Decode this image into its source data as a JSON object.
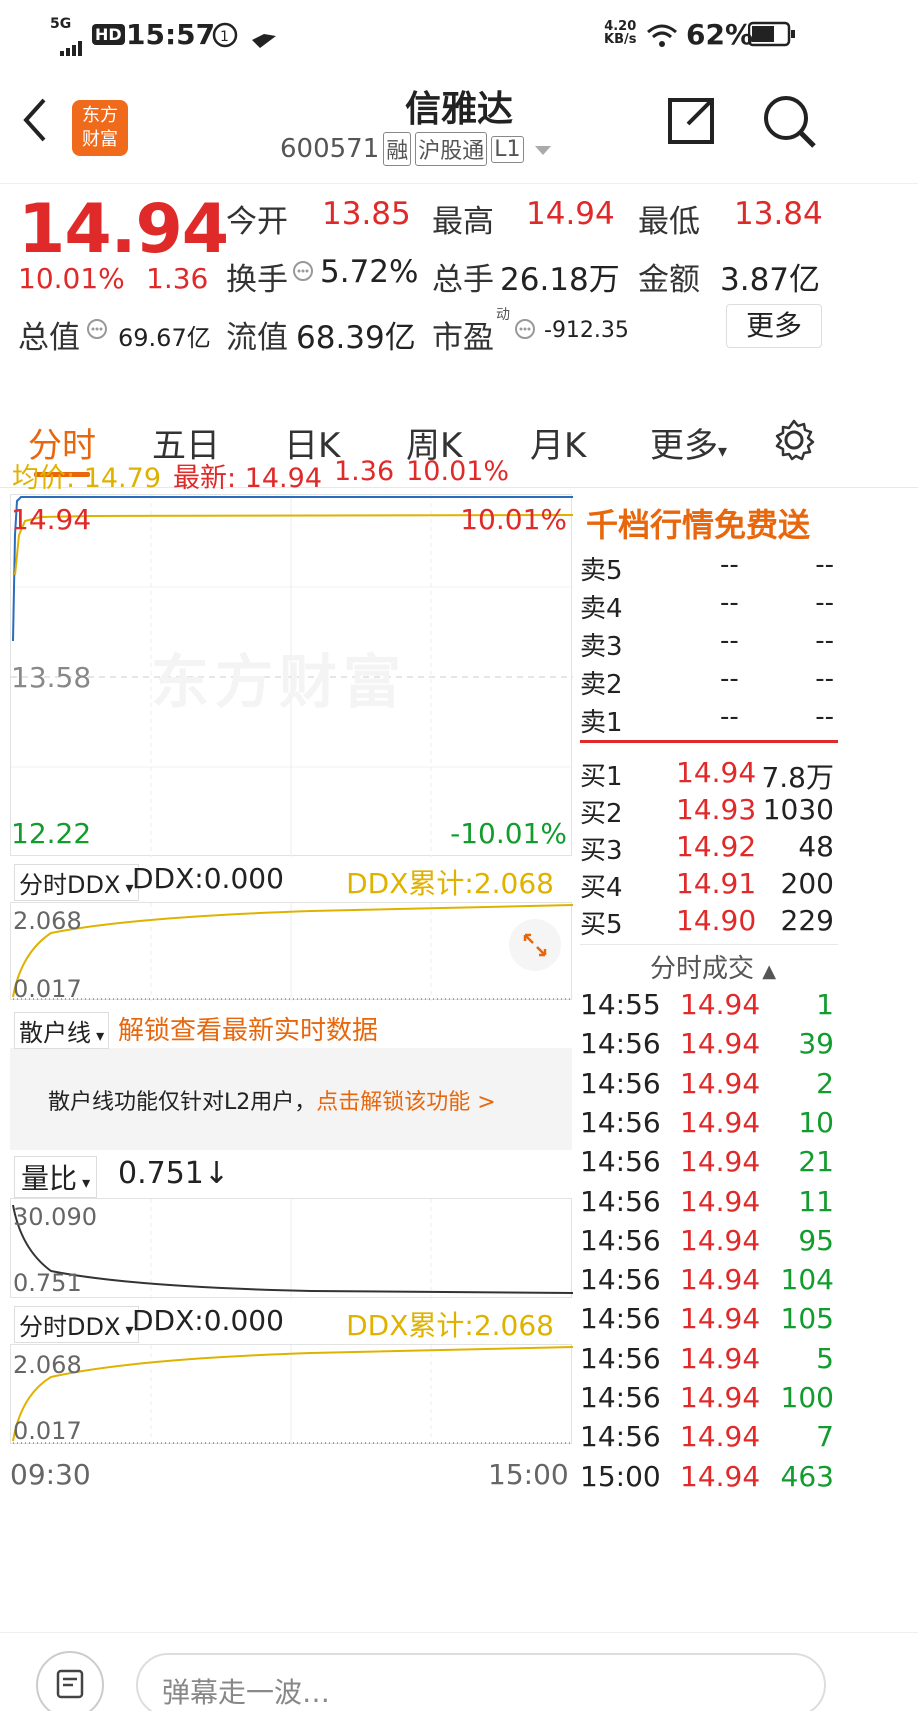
{
  "status": {
    "network": "5G",
    "hd": "HD",
    "time": "15:57",
    "speed_top": "4.20",
    "speed_bottom": "KB/s",
    "battery": "62%"
  },
  "header": {
    "title": "信雅达",
    "code": "600571",
    "badges": [
      "融",
      "沪股通",
      "L1"
    ],
    "logo_line1": "东方",
    "logo_line2": "财富"
  },
  "quote": {
    "price": "14.94",
    "change_pct": "10.01%",
    "change": "1.36",
    "open_label": "今开",
    "open": "13.85",
    "high_label": "最高",
    "high": "14.94",
    "low_label": "最低",
    "low": "13.84",
    "turnover_label": "换手",
    "turnover": "5.72%",
    "volume_label": "总手",
    "volume": "26.18万",
    "amount_label": "金额",
    "amount": "3.87亿",
    "mktcap_label": "总值",
    "mktcap": "69.67亿",
    "float_label": "流值",
    "float": "68.39亿",
    "pe_label": "市盈",
    "pe_sup": "动",
    "pe": "-912.35",
    "more": "更多"
  },
  "tabs": [
    "分时",
    "五日",
    "日K",
    "周K",
    "月K",
    "更多"
  ],
  "intraday": {
    "avg_label": "均价:",
    "avg": "14.79",
    "latest_label": "最新:",
    "latest": "14.94",
    "latest_change": "1.36",
    "latest_pct": "10.01%",
    "y_top": "14.94",
    "y_mid": "13.58",
    "y_bot": "12.22",
    "pct_top": "10.01%",
    "pct_bot": "-10.01%",
    "watermark": "东方财富",
    "time_start": "09:30",
    "time_end": "15:00"
  },
  "ddx1": {
    "selector": "分时DDX",
    "ddx": "DDX:0.000",
    "cum": "DDX累计:2.068",
    "y_top": "2.068",
    "y_bot": "0.017"
  },
  "retail": {
    "selector": "散户线",
    "promo": "解锁查看最新实时数据",
    "notice": "散户线功能仅针对L2用户，",
    "notice_link": "点击解锁该功能 >"
  },
  "volratio": {
    "selector": "量比",
    "value": "0.751↓",
    "y_top": "30.090",
    "y_bot": "0.751"
  },
  "ddx2": {
    "selector": "分时DDX",
    "ddx": "DDX:0.000",
    "cum": "DDX累计:2.068",
    "y_top": "2.068",
    "y_bot": "0.017"
  },
  "orderbook": {
    "banner": "千档行情免费送",
    "sells": [
      {
        "label": "卖5",
        "price": "--",
        "vol": "--"
      },
      {
        "label": "卖4",
        "price": "--",
        "vol": "--"
      },
      {
        "label": "卖3",
        "price": "--",
        "vol": "--"
      },
      {
        "label": "卖2",
        "price": "--",
        "vol": "--"
      },
      {
        "label": "卖1",
        "price": "--",
        "vol": "--"
      }
    ],
    "buys": [
      {
        "label": "买1",
        "price": "14.94",
        "vol": "7.8万"
      },
      {
        "label": "买2",
        "price": "14.93",
        "vol": "1030"
      },
      {
        "label": "买3",
        "price": "14.92",
        "vol": "48"
      },
      {
        "label": "买4",
        "price": "14.91",
        "vol": "200"
      },
      {
        "label": "买5",
        "price": "14.90",
        "vol": "229"
      }
    ]
  },
  "ticks": {
    "title": "分时成交",
    "rows": [
      {
        "time": "14:55",
        "price": "14.94",
        "vol": "1",
        "dir": "green"
      },
      {
        "time": "14:56",
        "price": "14.94",
        "vol": "39",
        "dir": "green"
      },
      {
        "time": "14:56",
        "price": "14.94",
        "vol": "2",
        "dir": "green"
      },
      {
        "time": "14:56",
        "price": "14.94",
        "vol": "10",
        "dir": "green"
      },
      {
        "time": "14:56",
        "price": "14.94",
        "vol": "21",
        "dir": "green"
      },
      {
        "time": "14:56",
        "price": "14.94",
        "vol": "11",
        "dir": "green"
      },
      {
        "time": "14:56",
        "price": "14.94",
        "vol": "95",
        "dir": "green"
      },
      {
        "time": "14:56",
        "price": "14.94",
        "vol": "104",
        "dir": "green"
      },
      {
        "time": "14:56",
        "price": "14.94",
        "vol": "105",
        "dir": "green"
      },
      {
        "time": "14:56",
        "price": "14.94",
        "vol": "5",
        "dir": "green"
      },
      {
        "time": "14:56",
        "price": "14.94",
        "vol": "100",
        "dir": "green"
      },
      {
        "time": "14:56",
        "price": "14.94",
        "vol": "7",
        "dir": "green"
      },
      {
        "time": "15:00",
        "price": "14.94",
        "vol": "463",
        "dir": "green"
      }
    ]
  },
  "bottom": {
    "danmu_placeholder": "弹幕走一波…"
  },
  "colors": {
    "up": "#e02a2a",
    "down": "#129c2e",
    "accent": "#e8670c",
    "gold": "#e0b200"
  }
}
